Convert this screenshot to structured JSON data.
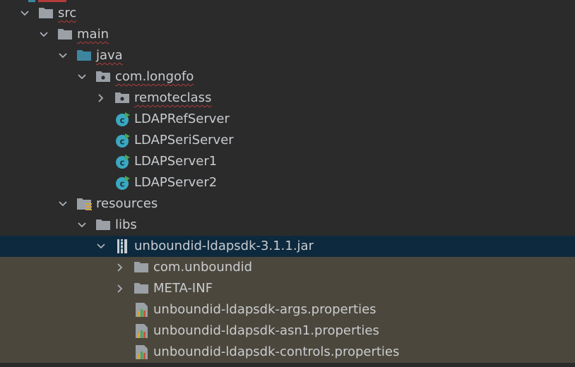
{
  "tree": {
    "nodes": [
      {
        "label": "src",
        "icon": "folder-icon",
        "expanded": true
      },
      {
        "label": "main",
        "icon": "folder-icon",
        "expanded": true
      },
      {
        "label": "java",
        "icon": "source-folder-icon",
        "expanded": true
      },
      {
        "label": "com.longofo",
        "icon": "package-icon",
        "expanded": true
      },
      {
        "label": "remoteclass",
        "icon": "package-icon",
        "expanded": false
      },
      {
        "label": "LDAPRefServer",
        "icon": "runnable-class-icon"
      },
      {
        "label": "LDAPSeriServer",
        "icon": "runnable-class-icon"
      },
      {
        "label": "LDAPServer1",
        "icon": "runnable-class-icon"
      },
      {
        "label": "LDAPServer2",
        "icon": "runnable-class-icon"
      },
      {
        "label": "resources",
        "icon": "resources-folder-icon",
        "expanded": true
      },
      {
        "label": "libs",
        "icon": "folder-icon",
        "expanded": true
      },
      {
        "label": "unboundid-ldapsdk-3.1.1.jar",
        "icon": "jar-icon",
        "expanded": true,
        "selected": true
      },
      {
        "label": "com.unboundid",
        "icon": "folder-icon",
        "expanded": false
      },
      {
        "label": "META-INF",
        "icon": "folder-icon",
        "expanded": false
      },
      {
        "label": "unboundid-ldapsdk-args.properties",
        "icon": "properties-file-icon"
      },
      {
        "label": "unboundid-ldapsdk-asn1.properties",
        "icon": "properties-file-icon"
      },
      {
        "label": "unboundid-ldapsdk-controls.properties",
        "icon": "properties-file-icon"
      }
    ]
  },
  "colors": {
    "background": "#2b2b2b",
    "selection": "#0d293e",
    "library_background": "#4c473c",
    "text": "#c9ccd0",
    "folder": "#9aa0a6",
    "source_folder": "#3e86a0",
    "class_icon": "#3aa8c1",
    "run_marker": "#4aa84a",
    "error_underline": "#b33b3b"
  }
}
